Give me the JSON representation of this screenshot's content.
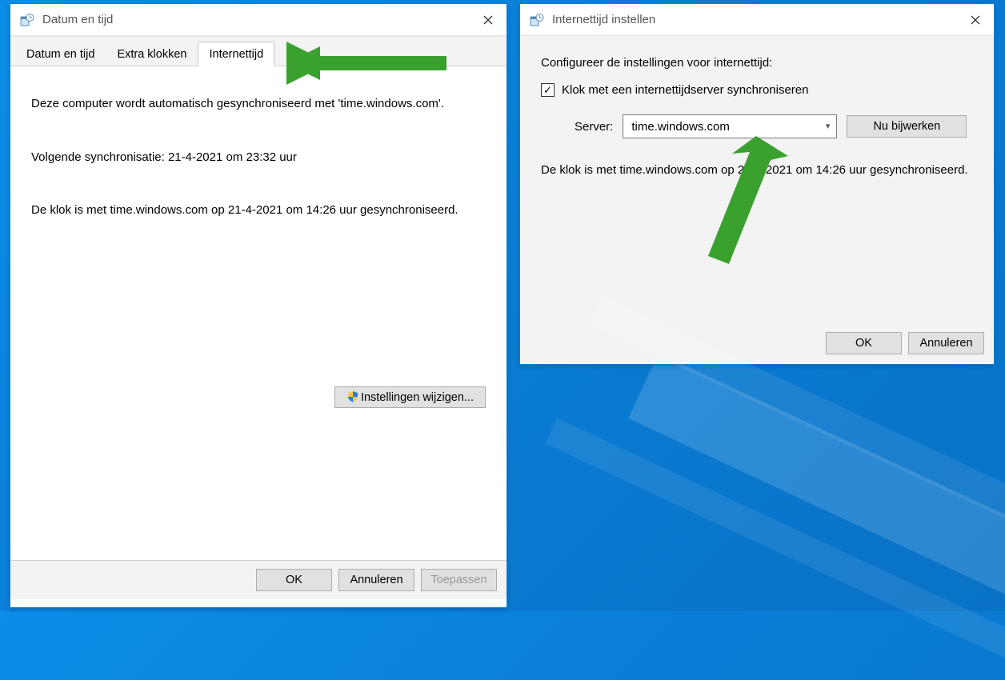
{
  "win1": {
    "title": "Datum en tijd",
    "tabs": [
      "Datum en tijd",
      "Extra klokken",
      "Internettijd"
    ],
    "active_tab": 2,
    "body": {
      "line1": "Deze computer wordt automatisch gesynchroniseerd met 'time.windows.com'.",
      "line2": "Volgende synchronisatie: 21-4-2021 om 23:32 uur",
      "line3": "De klok is met time.windows.com op 21-4-2021 om 14:26 uur gesynchroniseerd.",
      "change_settings_btn": "Instellingen wijzigen..."
    },
    "buttons": {
      "ok": "OK",
      "cancel": "Annuleren",
      "apply": "Toepassen"
    }
  },
  "win2": {
    "title": "Internettijd instellen",
    "intro": "Configureer de instellingen voor internettijd:",
    "checkbox_label": "Klok met een internettijdserver synchroniseren",
    "checkbox_checked": true,
    "server_label": "Server:",
    "server_value": "time.windows.com",
    "update_now_btn": "Nu bijwerken",
    "status": "De klok is met time.windows.com op 21-4-2021 om 14:26 uur gesynchroniseerd.",
    "buttons": {
      "ok": "OK",
      "cancel": "Annuleren"
    }
  }
}
